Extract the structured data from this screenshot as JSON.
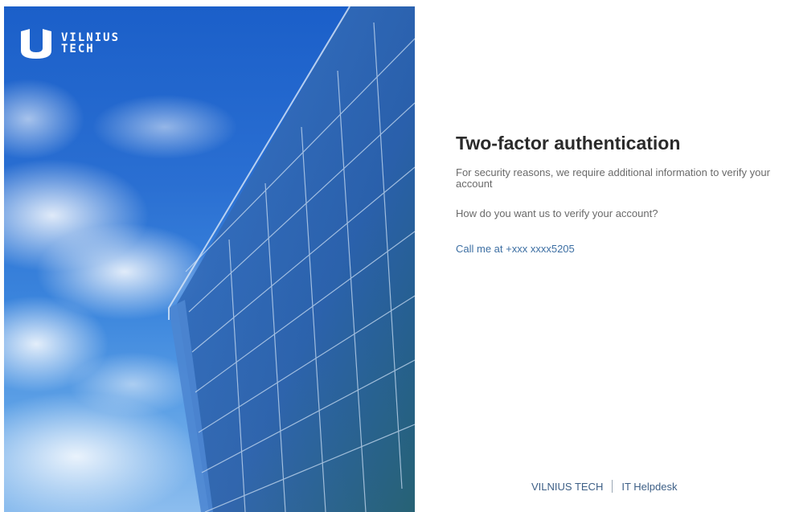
{
  "brand": {
    "line1": "VILNIUS",
    "line2": "TECH"
  },
  "main": {
    "title": "Two-factor authentication",
    "description": "For security reasons, we require additional information to verify your account",
    "question": "How do you want us to verify your account?",
    "call_option": "Call me at +xxx xxxx5205"
  },
  "footer": {
    "brand_link": "VILNIUS TECH",
    "helpdesk_link": "IT Helpdesk"
  },
  "colors": {
    "title": "#2b2b2b",
    "body_text": "#6a6a6a",
    "link": "#3d6fa3",
    "hero_sky": "#2a6fd2"
  }
}
